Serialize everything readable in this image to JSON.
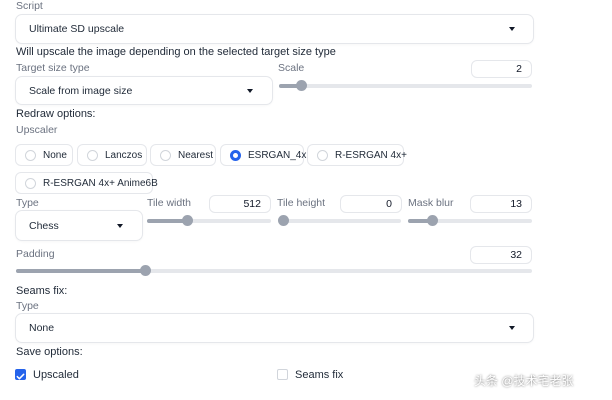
{
  "script": {
    "label": "Script",
    "value": "Ultimate SD upscale",
    "info": "Will upscale the image depending on the selected target size type"
  },
  "target_size": {
    "label": "Target size type",
    "value": "Scale from image size"
  },
  "scale": {
    "label": "Scale",
    "value": "2",
    "fraction": 0.09
  },
  "redraw": {
    "heading": "Redraw options:",
    "upscaler_label": "Upscaler"
  },
  "upscalers": [
    {
      "label": "None",
      "selected": false
    },
    {
      "label": "Lanczos",
      "selected": false
    },
    {
      "label": "Nearest",
      "selected": false
    },
    {
      "label": "ESRGAN_4x",
      "selected": true
    },
    {
      "label": "R-ESRGAN 4x+",
      "selected": false
    },
    {
      "label": "R-ESRGAN 4x+ Anime6B",
      "selected": false
    }
  ],
  "redraw_type": {
    "label": "Type",
    "value": "Chess"
  },
  "tile_width": {
    "label": "Tile width",
    "value": "512",
    "fraction": 0.33
  },
  "tile_height": {
    "label": "Tile height",
    "value": "0",
    "fraction": 0.0
  },
  "mask_blur": {
    "label": "Mask blur",
    "value": "13",
    "fraction": 0.2
  },
  "padding": {
    "label": "Padding",
    "value": "32",
    "fraction": 0.25
  },
  "seams": {
    "heading": "Seams fix:",
    "type_label": "Type",
    "type_value": "None"
  },
  "save": {
    "heading": "Save options:",
    "upscaled_label": "Upscaled",
    "upscaled_checked": true,
    "seams_label": "Seams fix",
    "seams_checked": false
  },
  "watermark": "头条 @技术宅老张",
  "colors": {
    "accent": "#2563eb",
    "slider": "#9ca3af",
    "track": "#e5e7eb",
    "border": "#e5e7eb"
  }
}
